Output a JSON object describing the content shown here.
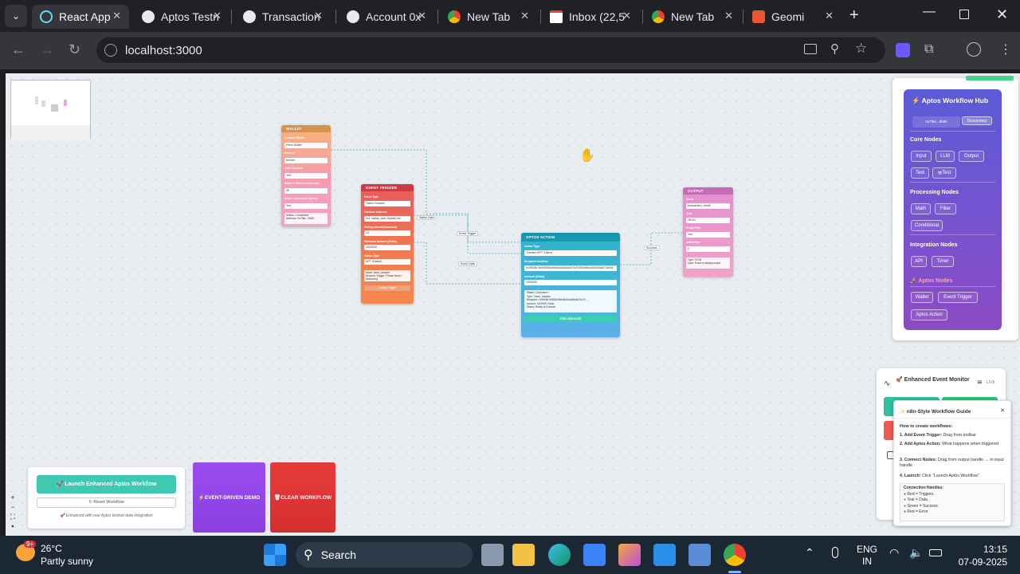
{
  "tabs": [
    {
      "label": "React App",
      "icon": "react-icon"
    },
    {
      "label": "Aptos Testn",
      "icon": "globe-icon"
    },
    {
      "label": "Transaction",
      "icon": "globe-icon"
    },
    {
      "label": "Account 0x",
      "icon": "globe-icon"
    },
    {
      "label": "New Tab",
      "icon": "chrome-icon"
    },
    {
      "label": "Inbox (22,5",
      "icon": "gmail-icon"
    },
    {
      "label": "New Tab",
      "icon": "chrome-icon"
    },
    {
      "label": "Geomi",
      "icon": "geomi-icon"
    }
  ],
  "address": "localhost:3000",
  "nodes": {
    "wallet": {
      "title": "WALLET",
      "f1l": "Connect Wallet",
      "f1": "Petra Wallet",
      "f2l": "Network",
      "f2": "testnet",
      "f3l": "Auto Connect",
      "f3": "Yes",
      "f4l": "Balance Refresh (seconds)",
      "f4": "30",
      "f5l": "Show Transaction History",
      "f5": "Yes",
      "status": "Status: Connected",
      "addr": "Address: 0x7f8e...b8d5"
    },
    "trigger": {
      "title": "EVENT TRIGGER",
      "f1l": "Event Type",
      "f1": "Token Transfer",
      "f2l": "Contract Address",
      "f2": "0x1::aptos_coin::AptosCoin",
      "f3l": "Polling Interval (seconds)",
      "f3": "10",
      "f4l": "Minimum Amount (Octas)",
      "f4": "1000000",
      "f5l": "Action Type",
      "f5": "APT (Native)",
      "info1": "Mode: token_transfer",
      "info2": "Network: Trigger / Phase Node / Monitoring",
      "btn": "Testing Trigger"
    },
    "action": {
      "title": "APTOS ACTION",
      "f1l": "Action Type",
      "f1": "Transfer APT Tokens",
      "f2l": "Recipient Address",
      "f2": "0x3f54fb7bb5384f3ed6b3a44a9c5a70c702f3ed6b2a5350ea627ab9a",
      "f3l": "Amount (Octas)",
      "f3": "1000000",
      "st1": "Wallet: Connected ✓",
      "st2": "Type: Token_transfer",
      "st3": "Recipient: 0x3f54fb7bb5384f3ed6b3a44a9c5a70c70...",
      "st4": "Amount: 1000000 Octas",
      "st5": "Status: Ready to Execute",
      "btn": "TEST EXECUTE"
    },
    "output": {
      "title": "OUTPUT",
      "f1l": "Name",
      "f1": "transaction_result",
      "f2l": "Type",
      "f2": "JSON",
      "f3l": "Pretty Print",
      "f3": "Yes",
      "f4l": "Indent Size",
      "f4": "2",
      "info1": "Type: JSON",
      "info2": "Input: Event-to-display.output"
    }
  },
  "edges": {
    "e1": "Wallet Data",
    "e2": "Event Trigger",
    "e3": "Event Data",
    "e4": "Success"
  },
  "hub": {
    "title": "Aptos Workflow Hub",
    "account": "0x7f8e...8b85",
    "disconnect": "Disconnect",
    "core": "Core Nodes",
    "core_items": [
      "Input",
      "LLM",
      "Output",
      "Text",
      "Test"
    ],
    "proc": "Processing Nodes",
    "proc_items": [
      "Math",
      "Filter",
      "Conditional"
    ],
    "integ": "Integration Nodes",
    "integ_items": [
      "API",
      "Timer"
    ],
    "aptos": "Aptos Nodes",
    "aptos_items": [
      "Wallet",
      "Event Trigger",
      "Aptos Action"
    ]
  },
  "monitor": {
    "title": "Enhanced Event Monitor",
    "live": "LIVE"
  },
  "guide": {
    "title": "n8n-Style Workflow Guide",
    "subtitle": "How to create workflows:",
    "s1b": "1. Add Event Trigger:",
    "s1": "Drag from toolbar",
    "s2b": "2. Add Aptos Action:",
    "s2": "What happens when triggered",
    "s3b": "3. Connect Nodes:",
    "s3": "Drag from output handle → to input handle",
    "s4b": "4. Launch:",
    "s4": "Click \"Launch Aptos Workflow\"",
    "handles_title": "Connection Handles:",
    "h1": "Red = Triggers",
    "h2": "Teal = Data",
    "h3": "Green = Success",
    "h4": "Red = Error"
  },
  "launch": {
    "main": "🚀 Launch Enhanced Aptos Workflow",
    "reset": "↻ Reset Workflow",
    "note": "Enhanced with real Aptos testnet data integration"
  },
  "demo_btn": "EVENT-DRIVEN DEMO",
  "clear_btn": "CLEAR WORKFLOW",
  "taskbar": {
    "temp": "26°C",
    "weather": "Partly sunny",
    "search": "Search",
    "lang1": "ENG",
    "lang2": "IN",
    "time": "13:15",
    "date": "07-09-2025",
    "badge": "9+"
  }
}
